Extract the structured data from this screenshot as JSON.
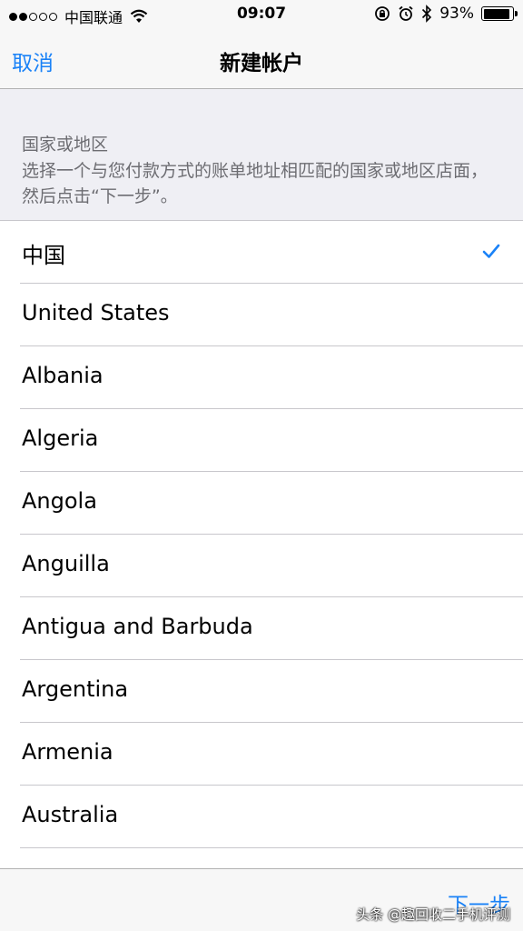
{
  "status_bar": {
    "carrier": "中国联通",
    "time": "09:07",
    "battery_percent": "93%",
    "battery_level": 0.93,
    "signal_dots_filled": 2,
    "signal_dots_total": 5
  },
  "nav": {
    "cancel_label": "取消",
    "title": "新建帐户"
  },
  "section": {
    "title": "国家或地区",
    "description": "选择一个与您付款方式的账单地址相匹配的国家或地区店面，然后点击“下一步”。"
  },
  "countries": [
    {
      "label": "中国",
      "selected": true
    },
    {
      "label": "United States",
      "selected": false
    },
    {
      "label": "Albania",
      "selected": false
    },
    {
      "label": "Algeria",
      "selected": false
    },
    {
      "label": "Angola",
      "selected": false
    },
    {
      "label": "Anguilla",
      "selected": false
    },
    {
      "label": "Antigua and Barbuda",
      "selected": false
    },
    {
      "label": "Argentina",
      "selected": false
    },
    {
      "label": "Armenia",
      "selected": false
    },
    {
      "label": "Australia",
      "selected": false
    }
  ],
  "toolbar": {
    "next_label": "下一步"
  },
  "watermark": "头条 @趣回收二手机评测",
  "colors": {
    "accent": "#1a82f7",
    "bar_background": "#f7f7f7",
    "group_background": "#efeff4",
    "separator": "#c8c7cc"
  },
  "icons": {
    "wifi": "wifi-icon",
    "rotation_lock": "rotation-lock-icon",
    "alarm": "alarm-icon",
    "bluetooth": "bluetooth-icon",
    "battery": "battery-icon",
    "checkmark": "checkmark-icon"
  }
}
